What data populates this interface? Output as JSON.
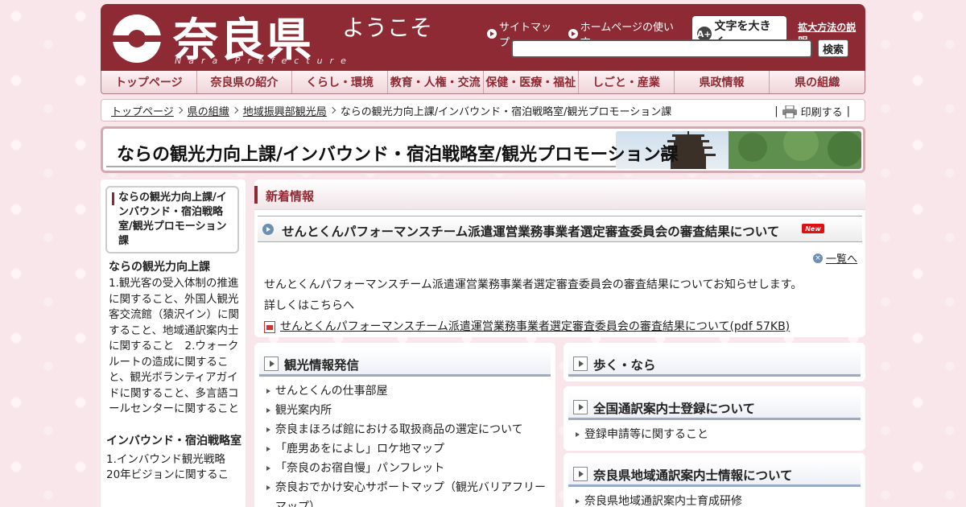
{
  "header": {
    "logo_text": "奈良県",
    "logo_sub": "Nara Prefecture",
    "welcome": "ようこそ",
    "links": [
      "サイトマップ",
      "ホームページの使い方"
    ],
    "bigtext_button": "文字を大きく",
    "bigtext_icon": "A+",
    "zoom_help": "拡大方法の説明",
    "search_placeholder": "",
    "search_button": "検索"
  },
  "nav": [
    "トップページ",
    "奈良県の紹介",
    "くらし・環境",
    "教育・人権・交流",
    "保健・医療・福祉",
    "しごと・産業",
    "県政情報",
    "県の組織"
  ],
  "breadcrumb": {
    "items": [
      "トップページ",
      "県の組織",
      "地域振興部観光局"
    ],
    "current": "ならの観光力向上課/インバウンド・宿泊戦略室/観光プロモーション課",
    "print_label": "印刷する"
  },
  "page_title": "ならの観光力向上課/インバウンド・宿泊戦略室/観光プロモーション課",
  "sidebar": {
    "current": "ならの観光力向上課/インバウンド・宿泊戦略室/観光プロモーション課",
    "section1_title": "ならの観光力向上課",
    "section1_text": "1.観光客の受入体制の推進に関すること、外国人観光客交流館（猿沢イン）に関すること、地域通訳案内士に関すること　2.ウォークルートの造成に関すること、観光ボランティアガイドに関すること、多言語コールセンターに関すること",
    "section2_title": "インバウンド・宿泊戦略室",
    "section2_text": "1.インバウンド観光戦略20年ビジョンに関するこ"
  },
  "news": {
    "heading": "新着情報",
    "item_title": "せんとくんパフォーマンスチーム派遣運営業務事業者選定審査委員会の審査結果について",
    "new_badge": "New",
    "list_link": "一覧へ",
    "body_line1": "せんとくんパフォーマンスチーム派遣運営業務事業者選定審査委員会の審査結果についてお知らせします。",
    "body_line2": "詳しくはこちらへ",
    "pdf_link": "せんとくんパフォーマンスチーム派遣運営業務事業者選定審査委員会の審査結果について(pdf 57KB)"
  },
  "panels": {
    "kanko": {
      "title": "観光情報発信",
      "items": [
        "せんとくんの仕事部屋",
        "観光案内所",
        "奈良まほろば館における取扱商品の選定について",
        "「鹿男あをによし」ロケ地マップ",
        "「奈良のお宿自慢」パンフレット",
        "奈良おでかけ安心サポートマップ（観光バリアフリーマップ）"
      ]
    },
    "aruku": {
      "title": "歩く・なら"
    },
    "tsuyaku": {
      "title": "全国通訳案内士登録について",
      "items": [
        "登録申請等に関すること"
      ]
    },
    "chiiki": {
      "title": "奈良県地域通訳案内士情報について",
      "items": [
        "奈良県地域通訳案内士育成研修"
      ]
    }
  },
  "colors": {
    "brand": "#8e2a33",
    "accent": "#6d8fb3",
    "background": "#f8e6ea"
  }
}
